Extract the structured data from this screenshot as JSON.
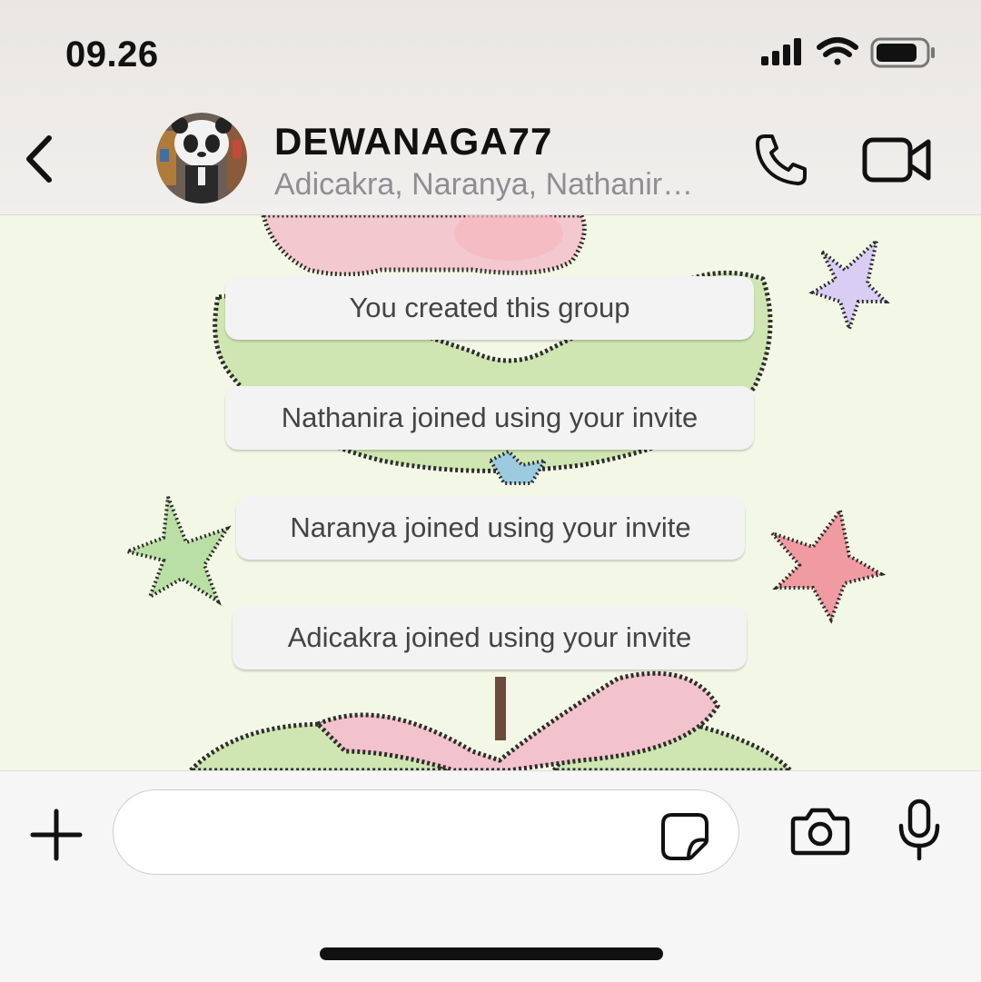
{
  "status_bar": {
    "time": "09.26",
    "icons": [
      "signal-icon",
      "wifi-icon",
      "battery-icon"
    ]
  },
  "header": {
    "back_icon": "chevron-left-icon",
    "group_name": "DEWANAGA77",
    "members": "Adicakra, Naranya, Nathanir…",
    "call_icon": "phone-icon",
    "video_icon": "video-camera-icon"
  },
  "messages": [
    {
      "text": "You created this group"
    },
    {
      "text": "Nathanira joined using your invite"
    },
    {
      "text": "Naranya joined using your invite"
    },
    {
      "text": "Adicakra joined using your invite"
    }
  ],
  "composer": {
    "plus_icon": "plus-icon",
    "input_value": "",
    "sticker_icon": "sticker-icon",
    "camera_icon": "camera-icon",
    "mic_icon": "microphone-icon"
  },
  "colors": {
    "accent_text": "#111111",
    "subtitle": "#8e8e93",
    "bubble_bg": "#f3f3f3",
    "wallpaper_bg": "#f3f8e6"
  }
}
